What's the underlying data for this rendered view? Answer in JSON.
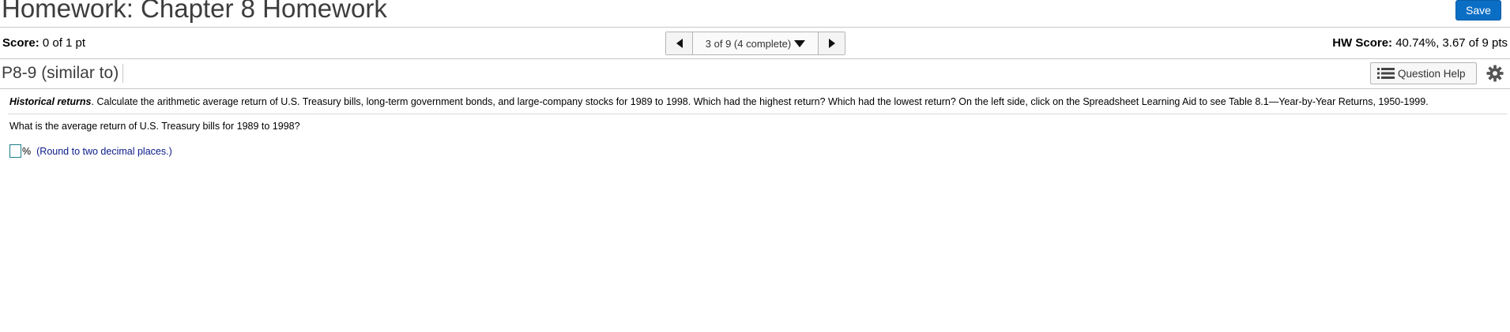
{
  "header": {
    "title": "Homework: Chapter 8 Homework",
    "save_label": "Save"
  },
  "scorebar": {
    "score_label": "Score:",
    "score_value": "0 of 1 pt",
    "question_selector": "3 of 9 (4 complete)",
    "hw_score_label": "HW Score:",
    "hw_score_value": "40.74%, 3.67 of 9 pts"
  },
  "question_header": {
    "id": "P8-9 (similar to)",
    "help_label": "Question Help"
  },
  "question": {
    "prompt_title": "Historical returns",
    "prompt_text": ".  Calculate the arithmetic average return of U.S. Treasury bills, long-term government bonds, and large-company stocks for 1989 to 1998.  Which had the highest return?  Which had the lowest return?  On the left side, click on the Spreadsheet Learning Aid to see Table 8.1—Year-by-Year Returns, 1950-1999.",
    "ask": "What is the average return of U.S. Treasury bills for 1989 to 1998?",
    "answer_value": "",
    "unit": "%",
    "hint": "(Round to two decimal places.)"
  },
  "icons": {
    "prev": "caret-left-icon",
    "next": "caret-right-icon",
    "dropdown": "caret-down-icon",
    "help": "list-icon",
    "settings": "gear-icon"
  },
  "colors": {
    "save_button": "#0b6ec5",
    "hint_text": "#0b1a8a",
    "answer_border": "#1b7d8a"
  }
}
